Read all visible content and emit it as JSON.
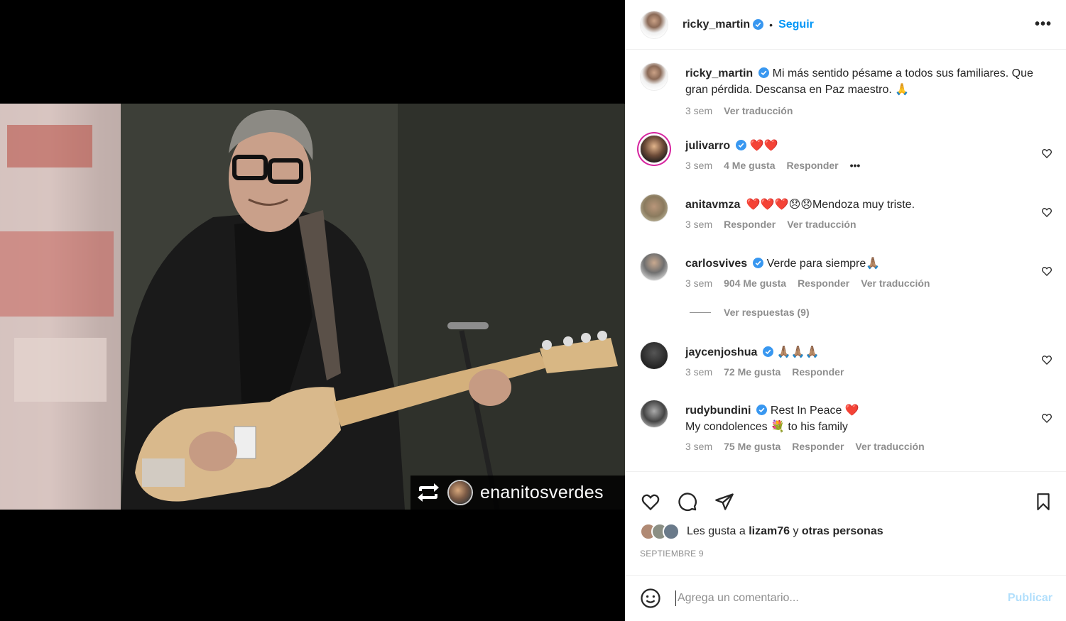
{
  "post": {
    "author": "ricky_martin",
    "follow_label": "Seguir",
    "separator": "•",
    "more_label": "•••",
    "repost_name": "enanitosverdes"
  },
  "caption": {
    "username": "ricky_martin",
    "text": "Mi más sentido pésame a todos sus familiares. Que gran pérdida. Descansa en Paz maestro. 🙏",
    "time": "3 sem",
    "translate": "Ver traducción"
  },
  "comments": [
    {
      "username": "julivarro",
      "text": "❤️❤️",
      "time": "3 sem",
      "likes": "4 Me gusta",
      "reply": "Responder",
      "extra": "•••"
    },
    {
      "username": "anitavmza",
      "text": "❤️❤️❤️😞😞Mendoza muy triste.",
      "time": "3 sem",
      "reply": "Responder",
      "translate": "Ver traducción"
    },
    {
      "username": "carlosvives",
      "text": "Verde para siempre🙏🏽",
      "time": "3 sem",
      "likes": "904 Me gusta",
      "reply": "Responder",
      "translate": "Ver traducción"
    },
    {
      "username": "jaycenjoshua",
      "text": "🙏🏽🙏🏽🙏🏽",
      "time": "3 sem",
      "likes": "72 Me gusta",
      "reply": "Responder"
    },
    {
      "username": "rudybundini",
      "text": "Rest In Peace ❤️",
      "text2": "My condolences 💐 to his family",
      "time": "3 sem",
      "likes": "75 Me gusta",
      "reply": "Responder",
      "translate": "Ver traducción"
    }
  ],
  "view_replies": "Ver respuestas (9)",
  "likes_line": {
    "prefix": "Les gusta a",
    "user": "lizam76",
    "conj": "y",
    "others": "otras personas"
  },
  "date": "SEPTIEMBRE 9",
  "add_comment": {
    "placeholder": "Agrega un comentario...",
    "publish": "Publicar"
  },
  "colors": {
    "accent": "#0095f6",
    "verified": "#3897f0",
    "publish_disabled": "#b2dffc"
  }
}
